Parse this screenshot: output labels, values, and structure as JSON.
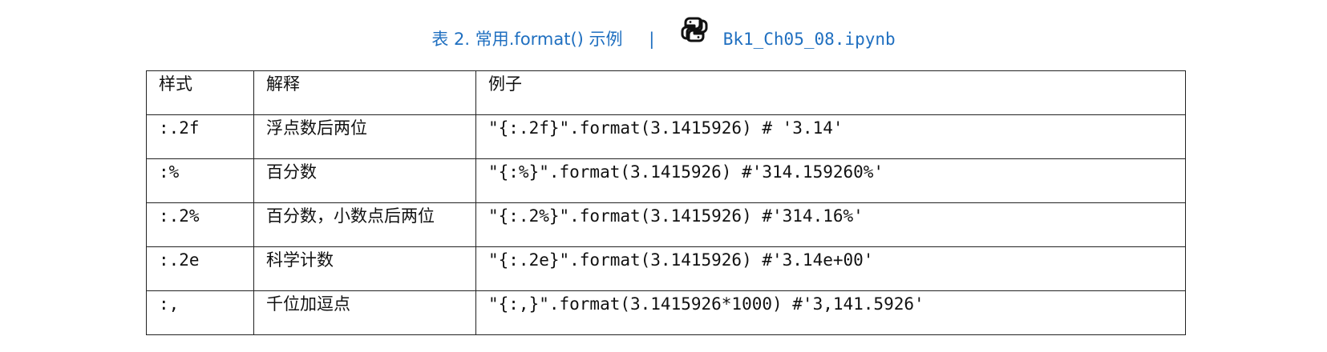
{
  "caption": {
    "label": "表 2. 常用.format() 示例",
    "separator": "|",
    "icon": "python-icon",
    "notebook": "Bk1_Ch05_08.ipynb",
    "color": "#1f6fc0"
  },
  "table": {
    "headers": [
      "样式",
      "解释",
      "例子"
    ],
    "rows": [
      [
        ":.2f",
        "浮点数后两位",
        "\"{:.2f}\".format(3.1415926) # '3.14'"
      ],
      [
        ":%",
        "百分数",
        "\"{:%}\".format(3.1415926) #'314.159260%'"
      ],
      [
        ":.2%",
        "百分数，小数点后两位",
        "\"{:.2%}\".format(3.1415926) #'314.16%'"
      ],
      [
        ":.2e",
        "科学计数",
        "\"{:.2e}\".format(3.1415926) #'3.14e+00'"
      ],
      [
        ":,",
        "千位加逗点",
        "\"{:,}\".format(3.1415926*1000) #'3,141.5926'"
      ]
    ]
  }
}
